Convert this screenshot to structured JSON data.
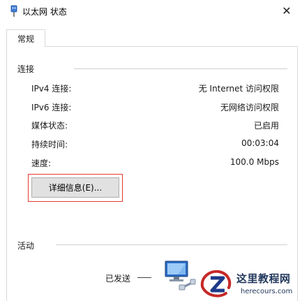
{
  "window": {
    "title": "以太网 状态",
    "close_glyph": "✕"
  },
  "tabs": [
    {
      "label": "常规",
      "selected": true
    }
  ],
  "connection": {
    "group_label": "连接",
    "rows": [
      {
        "label": "IPv4 连接:",
        "value": "无 Internet 访问权限"
      },
      {
        "label": "IPv6 连接:",
        "value": "无网络访问权限"
      },
      {
        "label": "媒体状态:",
        "value": "已启用"
      },
      {
        "label": "持续时间:",
        "value": "00:03:04"
      },
      {
        "label": "速度:",
        "value": "100.0 Mbps"
      }
    ],
    "details_button": "详细信息(E)..."
  },
  "activity": {
    "group_label": "活动",
    "sent_label": "已发送"
  },
  "watermark": {
    "title": "这里教程网",
    "url": "herecours.com"
  },
  "colors": {
    "highlight": "#e53935",
    "button_bg": "#e1e1e1",
    "watermark_text": "#23395d"
  }
}
